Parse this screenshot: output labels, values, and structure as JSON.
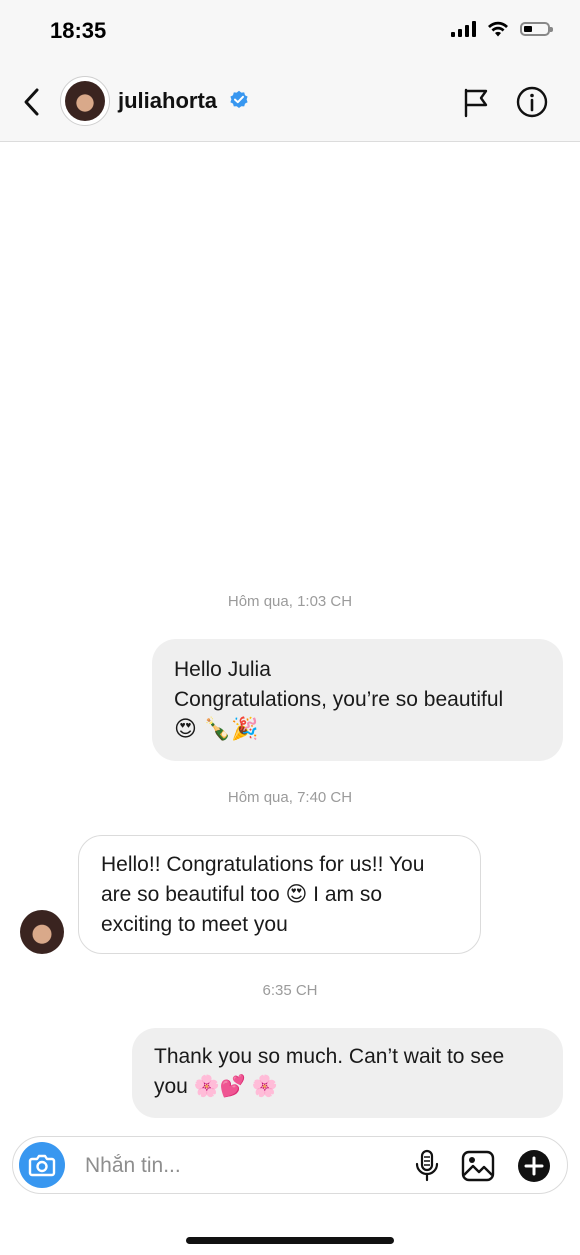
{
  "status_bar": {
    "time": "18:35"
  },
  "header": {
    "username": "juliahorta",
    "verified": true,
    "icons": [
      "back-chevron-icon",
      "verified-badge-icon",
      "flag-icon",
      "info-icon"
    ]
  },
  "messages": [
    {
      "timestamp": "Hôm qua, 1:03 CH"
    },
    {
      "direction": "outgoing",
      "lines": [
        "Hello Julia",
        "Congratulations, you’re so beautiful",
        "😍 🍾🎉"
      ]
    },
    {
      "timestamp": "Hôm qua, 7:40 CH"
    },
    {
      "direction": "incoming",
      "lines": [
        "Hello!! Congratulations for us!! You",
        "are so beautiful too 😍 I am so",
        "exciting to meet you"
      ]
    },
    {
      "timestamp": "6:35 CH"
    },
    {
      "direction": "outgoing",
      "lines": [
        "Thank you so much. Can’t wait to see",
        "you 🌸💕 🌸"
      ]
    }
  ],
  "composer": {
    "placeholder": "Nhắn tin...",
    "icons": [
      "camera-icon",
      "microphone-icon",
      "gallery-icon",
      "plus-icon"
    ]
  },
  "colors": {
    "accent": "#3897f0",
    "outgoing_bubble": "#efefef",
    "incoming_border": "#dbdbdb",
    "timestamp": "#9b9b9b"
  }
}
